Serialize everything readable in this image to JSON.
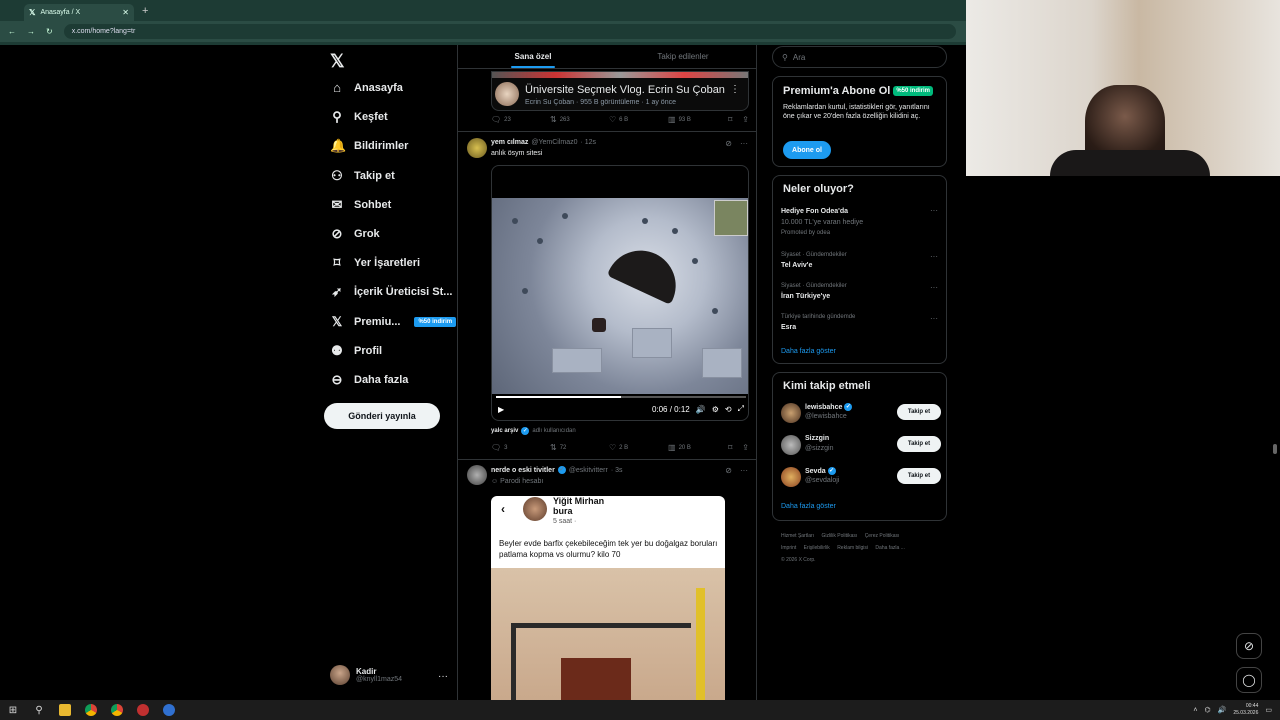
{
  "browser": {
    "tab_title": "Anasayfa / X",
    "url": "x.com/home?lang=tr"
  },
  "nav": {
    "items": [
      {
        "label": "Anasayfa",
        "icon": "home-icon",
        "glyph": "⌂"
      },
      {
        "label": "Keşfet",
        "icon": "search-icon",
        "glyph": "⚲"
      },
      {
        "label": "Bildirimler",
        "icon": "bell-icon",
        "glyph": "🔔"
      },
      {
        "label": "Takip et",
        "icon": "person-add-icon",
        "glyph": "⚇"
      },
      {
        "label": "Sohbet",
        "icon": "mail-icon",
        "glyph": "✉"
      },
      {
        "label": "Grok",
        "icon": "grok-icon",
        "glyph": "⊘"
      },
      {
        "label": "Yer İşaretleri",
        "icon": "bookmark-icon",
        "glyph": "⌑"
      },
      {
        "label": "İçerik Üreticisi St...",
        "icon": "rocket-icon",
        "glyph": "➶"
      },
      {
        "label": "Premiu...",
        "icon": "x-premium-icon",
        "glyph": "𝕏"
      },
      {
        "label": "Profil",
        "icon": "profile-icon",
        "glyph": "⚉"
      },
      {
        "label": "Daha fazla",
        "icon": "more-circle-icon",
        "glyph": "⊖"
      }
    ],
    "premium_badge": "%50 indirim",
    "post_button": "Gönderi yayınla",
    "account": {
      "name": "Kadir",
      "handle": "@knyll1maz54"
    }
  },
  "feed": {
    "tabs": [
      "Sana özel",
      "Takip edilenler"
    ],
    "yt_card": {
      "title": "Üniversite Seçmek Vlog. Ecrin Su Çoban",
      "meta": "Ecrin Su Çoban · 955 B görüntüleme · 1 ay önce"
    },
    "tweet1_actions": {
      "replies": "23",
      "retweets": "263",
      "likes": "6 B",
      "views": "93 B"
    },
    "tweet2": {
      "name": "yem cılmaz",
      "handle": "@YemCilmaz0",
      "time": "· 12s",
      "text": "anlık ösym sitesi",
      "video_time": "0:06 / 0:12",
      "source_name": "yalc arşiv",
      "source_suffix": "adlı kullanıcıdan",
      "progress": 0.5,
      "actions": {
        "replies": "3",
        "retweets": "72",
        "likes": "2 B",
        "views": "20 B"
      }
    },
    "tweet3": {
      "name": "nerde o eski tivitler",
      "handle": "@eskitvitterr",
      "time": "· 3s",
      "parody": "Parodi hesabı",
      "fb_name": "Yiğit Mirhan bura",
      "fb_time": "5 saat ·",
      "fb_text": "Beyler evde barfix çekebileceğim tek yer bu doğalgaz boruları patlama kopma vs olurmu? kilo 70"
    }
  },
  "sidebar": {
    "search_placeholder": "Ara",
    "premium": {
      "title": "Premium'a Abone Ol",
      "badge": "%50 indirim",
      "text": "Reklamlardan kurtul, istatistikleri gör, yanıtlarını öne çıkar ve 20'den fazla özelliğin kilidini aç.",
      "button": "Abone ol"
    },
    "trends": {
      "title": "Neler oluyor?",
      "items": [
        {
          "category": "",
          "name": "Hediye Fon Odea'da",
          "extra": "10.000 TL'ye varan hediye",
          "promoted": "Promoted by odea"
        },
        {
          "category": "Siyaset · Gündemdekiler",
          "name": "Tel Aviv'e"
        },
        {
          "category": "Siyaset · Gündemdekiler",
          "name": "İran Türkiye'ye"
        },
        {
          "category": "Türkiye tarihinde gündemde",
          "name": "Esra"
        }
      ],
      "show_more": "Daha fazla göster"
    },
    "who_to_follow": {
      "title": "Kimi takip etmeli",
      "users": [
        {
          "name": "lewisbahce",
          "handle": "@lewisbahce",
          "verified": true
        },
        {
          "name": "Sizzgin",
          "handle": "@sizzgin",
          "verified": false
        },
        {
          "name": "Sevda",
          "handle": "@sevdaloji",
          "verified": true
        }
      ],
      "follow_label": "Takip et",
      "show_more": "Daha fazla göster"
    },
    "footer": [
      "Hizmet Şartları",
      "Gizlilik Politikası",
      "Çerez Politikası",
      "Imprint",
      "Erişilebilirlik",
      "Reklam bilgisi",
      "Daha fazla ...",
      "© 2026 X Corp."
    ]
  },
  "taskbar": {
    "time": "00:44",
    "date": "25.03.2026"
  }
}
